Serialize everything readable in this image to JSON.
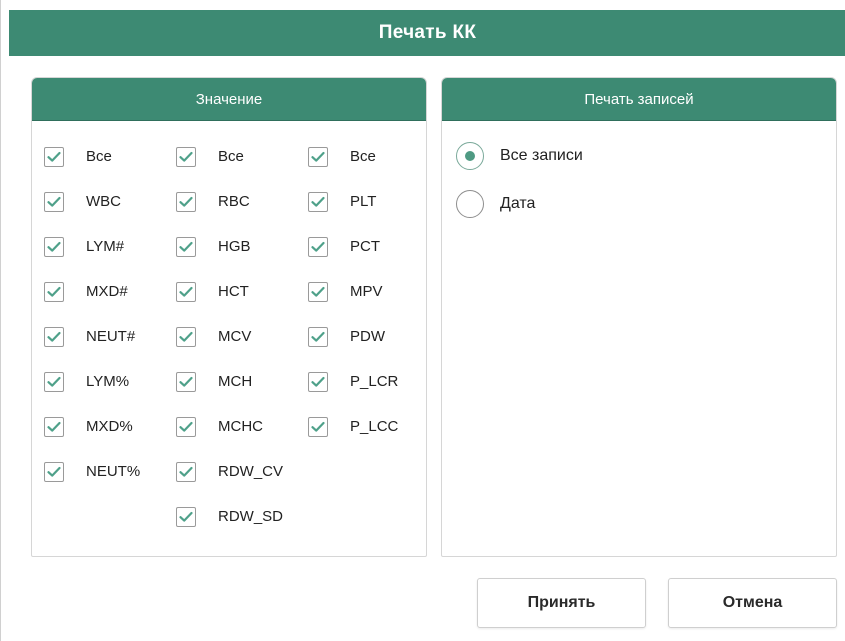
{
  "dialog": {
    "title": "Печать КК",
    "accent_color": "#3d8a73"
  },
  "values_panel": {
    "header": "Значение",
    "columns": [
      {
        "items": [
          {
            "label": "Все",
            "checked": true
          },
          {
            "label": "WBC",
            "checked": true
          },
          {
            "label": "LYM#",
            "checked": true
          },
          {
            "label": "MXD#",
            "checked": true
          },
          {
            "label": "NEUT#",
            "checked": true
          },
          {
            "label": "LYM%",
            "checked": true
          },
          {
            "label": "MXD%",
            "checked": true
          },
          {
            "label": "NEUT%",
            "checked": true
          }
        ]
      },
      {
        "items": [
          {
            "label": "Все",
            "checked": true
          },
          {
            "label": "RBC",
            "checked": true
          },
          {
            "label": "HGB",
            "checked": true
          },
          {
            "label": "HCT",
            "checked": true
          },
          {
            "label": "MCV",
            "checked": true
          },
          {
            "label": "MCH",
            "checked": true
          },
          {
            "label": "MCHC",
            "checked": true
          },
          {
            "label": "RDW_CV",
            "checked": true
          },
          {
            "label": "RDW_SD",
            "checked": true
          }
        ]
      },
      {
        "items": [
          {
            "label": "Все",
            "checked": true
          },
          {
            "label": "PLT",
            "checked": true
          },
          {
            "label": "PCT",
            "checked": true
          },
          {
            "label": "MPV",
            "checked": true
          },
          {
            "label": "PDW",
            "checked": true
          },
          {
            "label": "P_LCR",
            "checked": true
          },
          {
            "label": "P_LCC",
            "checked": true
          }
        ]
      }
    ]
  },
  "records_panel": {
    "header": "Печать записей",
    "options": [
      {
        "label": "Все записи",
        "selected": true
      },
      {
        "label": "Дата",
        "selected": false
      }
    ]
  },
  "buttons": {
    "accept_label": "Принять",
    "cancel_label": "Отмена"
  }
}
